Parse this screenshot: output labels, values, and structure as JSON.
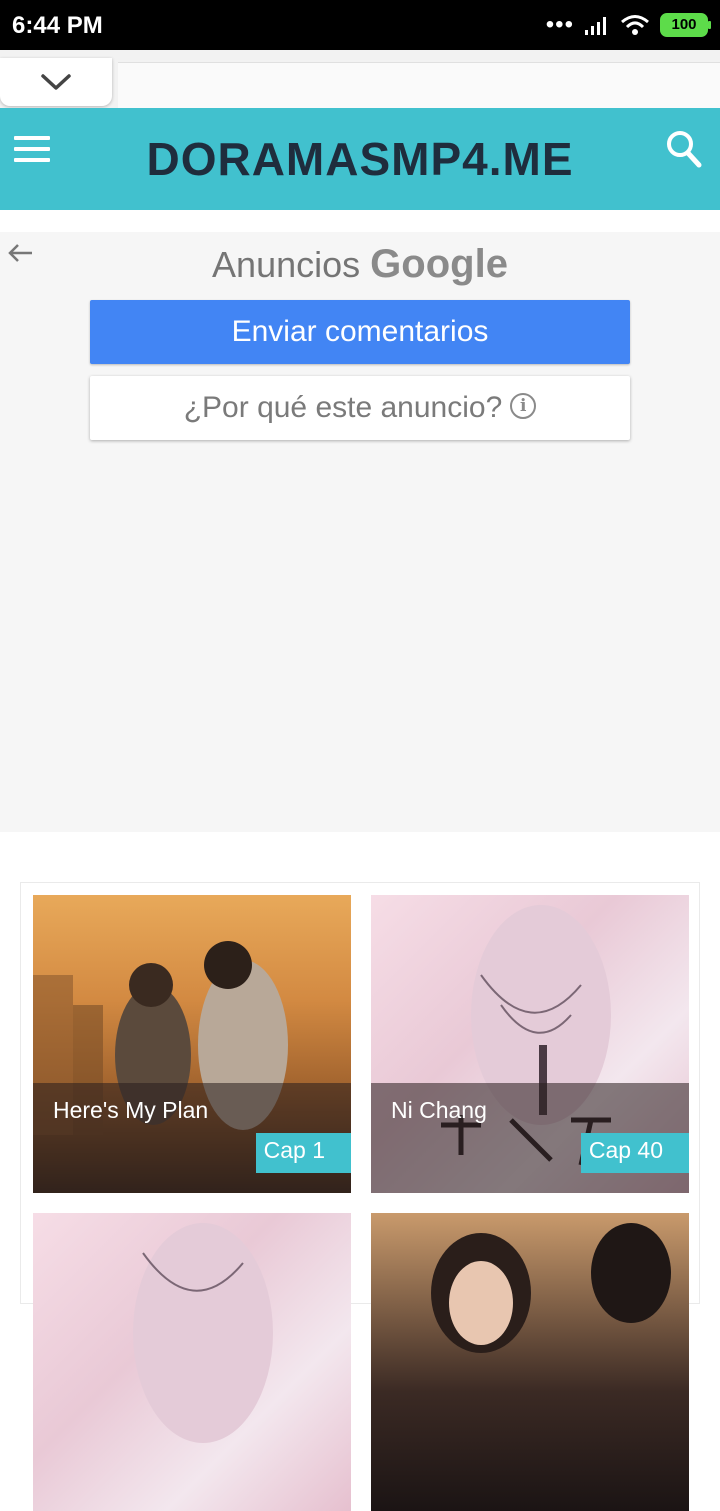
{
  "status_bar": {
    "time": "6:44 PM",
    "battery": "100"
  },
  "header": {
    "site_title": "DORAMASMP4.ME"
  },
  "ad": {
    "label_prefix": "Anuncios",
    "label_brand": "Google",
    "feedback_button": "Enviar comentarios",
    "why_button": "¿Por qué este anuncio?"
  },
  "cards": [
    {
      "title": "Here's My Plan",
      "cap": "Cap 1"
    },
    {
      "title": "Ni Chang",
      "cap": "Cap 40"
    }
  ],
  "colors": {
    "accent": "#41c1ce",
    "title_text": "#1f2d3d",
    "ad_button": "#4285f4"
  }
}
